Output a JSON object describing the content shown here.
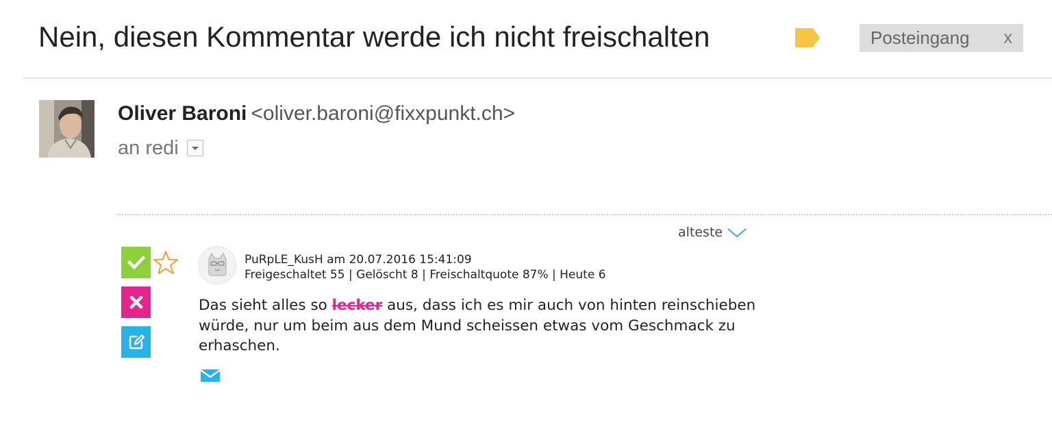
{
  "email": {
    "subject": "Nein, diesen Kommentar werde ich nicht freischalten",
    "label_icon": "label-tag-icon",
    "label_color": "#F6C544",
    "inbox_chip": {
      "label": "Posteingang",
      "close": "x"
    },
    "sender": {
      "name": "Oliver Baroni",
      "email": "<oliver.baroni@fixxpunkt.ch>"
    },
    "recipient_prefix": "an",
    "recipient_name": "redi"
  },
  "moderation": {
    "sort_label": "alteste",
    "accent_colors": {
      "approve": "#8CD13B",
      "reject": "#E6238F",
      "edit": "#25B3E8",
      "star": "#F0A030"
    },
    "actions": {
      "approve_icon": "check-icon",
      "reject_icon": "x-icon",
      "edit_icon": "edit-icon",
      "favorite_icon": "star-icon",
      "mail_icon": "envelope-icon"
    },
    "comment": {
      "author": "PuRpLE_KusH",
      "date_prefix": "am",
      "date": "20.07.2016 15:41:09",
      "stats": "Freigeschaltet 55 | Gelöscht 8 | Freischaltquote 87% | Heute 6",
      "text_before": "Das sieht alles so ",
      "struck_word": "lecker",
      "text_after": " aus, dass ich es mir auch von hinten reinschieben würde, nur um beim aus dem Mund scheissen etwas vom Geschmack zu erhaschen."
    }
  }
}
